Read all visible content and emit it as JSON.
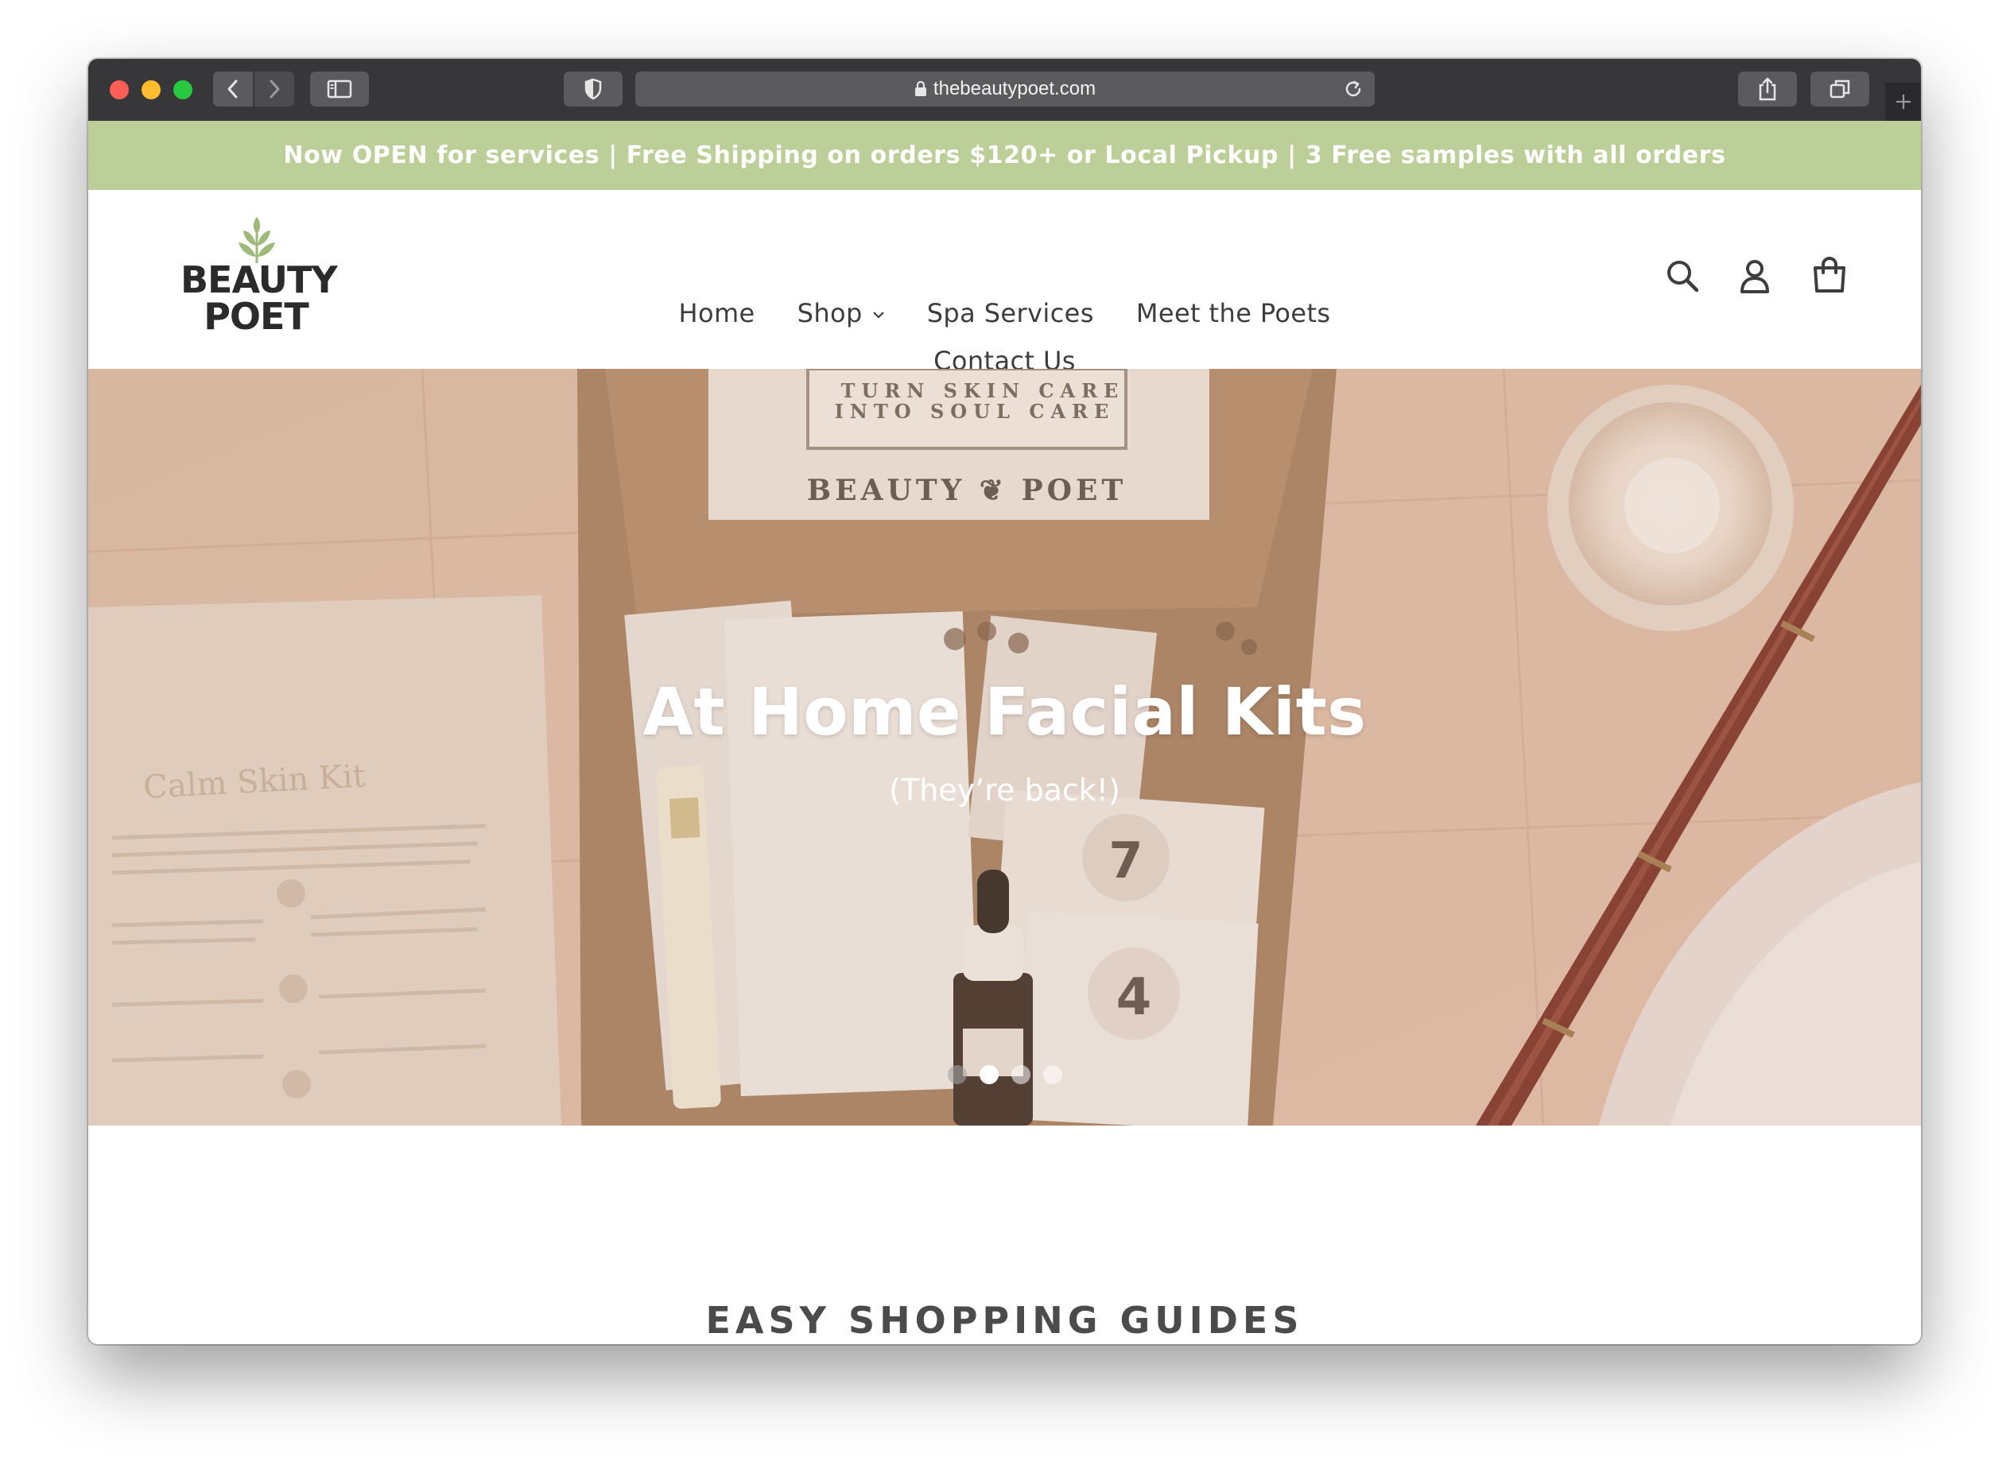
{
  "browser": {
    "url": "thebeautypoet.com"
  },
  "announcement": {
    "text": "Now OPEN for services | Free Shipping on orders $120+ or Local Pickup | 3 Free samples with all orders"
  },
  "header": {
    "logo_line1": "BEAUTY",
    "logo_line2": "POET",
    "nav_row1": [
      {
        "label": "Home"
      },
      {
        "label": "Shop"
      },
      {
        "label": "Spa Services"
      },
      {
        "label": "Meet the Poets"
      }
    ],
    "nav_row2": [
      {
        "label": "Contact Us"
      }
    ],
    "icons": [
      "search-icon",
      "account-icon",
      "cart-icon"
    ]
  },
  "hero": {
    "title": "At Home Facial Kits",
    "subtitle": "(They’re back!)",
    "box_text1": "TURN SKIN CARE",
    "box_text2": "INTO SOUL CARE",
    "box_brand": "BEAUTY ❦ POET",
    "card_title": "Calm Skin Kit",
    "slides_total": 4,
    "active_slide": 2
  },
  "section": {
    "title": "EASY SHOPPING GUIDES"
  },
  "colors": {
    "announcement_bg": "#bdcf98",
    "toolbar_bg": "#373739",
    "logo_leaf": "#9dba78",
    "text_dark": "#3d3d3d"
  }
}
